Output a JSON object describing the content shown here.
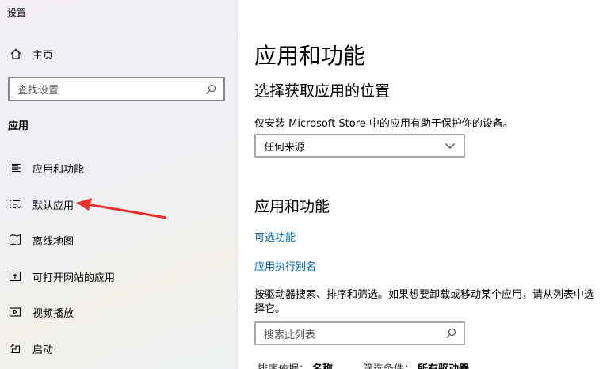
{
  "window": {
    "title": "设置"
  },
  "sidebar": {
    "home_label": "主页",
    "search_placeholder": "查找设置",
    "section_label": "应用",
    "items": [
      {
        "label": "应用和功能",
        "icon": "apps-list-icon"
      },
      {
        "label": "默认应用",
        "icon": "default-apps-icon"
      },
      {
        "label": "离线地图",
        "icon": "offline-map-icon"
      },
      {
        "label": "可打开网站的应用",
        "icon": "open-website-icon"
      },
      {
        "label": "视频播放",
        "icon": "video-playback-icon"
      },
      {
        "label": "启动",
        "icon": "startup-icon"
      }
    ]
  },
  "main": {
    "title": "应用和功能",
    "install_section": {
      "heading": "选择获取应用的位置",
      "description": "仅安装 Microsoft Store 中的应用有助于保护你的设备。",
      "dropdown_value": "任何来源"
    },
    "apps_section": {
      "heading": "应用和功能",
      "link_optional_features": "可选功能",
      "link_app_aliases": "应用执行别名",
      "description": "按驱动器搜索、排序和筛选。如果想要卸载或移动某个应用，请从列表中选择它。",
      "search_placeholder": "搜索此列表",
      "sort_label": "排序依据：",
      "sort_value": "名称",
      "filter_label": "筛选条件：",
      "filter_value": "所有驱动器"
    }
  },
  "annotation": {
    "color": "#e8302e"
  }
}
